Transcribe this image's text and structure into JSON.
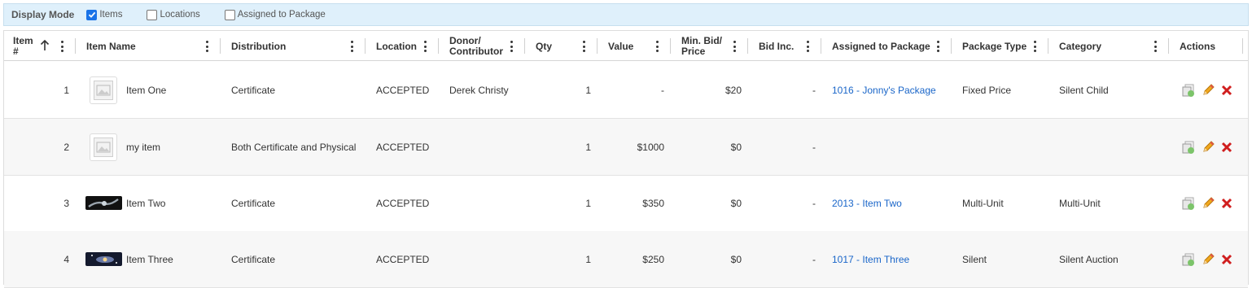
{
  "display_mode": {
    "label": "Display Mode",
    "options": [
      {
        "label": "Items",
        "checked": true
      },
      {
        "label": "Locations",
        "checked": false
      },
      {
        "label": "Assigned to Package",
        "checked": false
      }
    ]
  },
  "columns": {
    "item_no": [
      "Item",
      "#"
    ],
    "item_name": "Item Name",
    "distribution": "Distribution",
    "location": "Location",
    "donor": [
      "Donor/",
      "Contributor"
    ],
    "qty": "Qty",
    "value": "Value",
    "min_bid": [
      "Min. Bid/",
      "Price"
    ],
    "bid_inc": "Bid Inc.",
    "assigned": "Assigned to Package",
    "package_type": "Package Type",
    "category": "Category",
    "actions": "Actions"
  },
  "rows": [
    {
      "num": "1",
      "name": "Item One",
      "thumb": "placeholder",
      "distribution": "Certificate",
      "location": "ACCEPTED",
      "donor": "Derek Christy",
      "qty": "1",
      "value": "-",
      "min_bid": "$20",
      "bid_inc": "-",
      "assigned": "1016 - Jonny's Package",
      "package_type": "Fixed Price",
      "category": "Silent Child"
    },
    {
      "num": "2",
      "name": "my item",
      "thumb": "placeholder",
      "distribution": "Both Certificate and Physical",
      "location": "ACCEPTED",
      "donor": "",
      "qty": "1",
      "value": "$1000",
      "min_bid": "$0",
      "bid_inc": "-",
      "assigned": "",
      "package_type": "",
      "category": ""
    },
    {
      "num": "3",
      "name": "Item Two",
      "thumb": "photo-dark",
      "distribution": "Certificate",
      "location": "ACCEPTED",
      "donor": "",
      "qty": "1",
      "value": "$350",
      "min_bid": "$0",
      "bid_inc": "-",
      "assigned": "2013 - Item Two",
      "package_type": "Multi-Unit",
      "category": "Multi-Unit"
    },
    {
      "num": "4",
      "name": "Item Three",
      "thumb": "photo-space",
      "distribution": "Certificate",
      "location": "ACCEPTED",
      "donor": "",
      "qty": "1",
      "value": "$250",
      "min_bid": "$0",
      "bid_inc": "-",
      "assigned": "1017 - Item Three",
      "package_type": "Silent",
      "category": "Silent Auction"
    }
  ],
  "icons": {
    "checkbox": "checkbox-icon",
    "sort": "sort-ascending-icon",
    "column_menu": "kebab-menu-icon",
    "placeholder": "no-image-icon",
    "copy": "copy-icon",
    "edit": "pencil-icon",
    "delete": "delete-x-icon"
  },
  "colors": {
    "topbar_bg": "#dff0fb",
    "link": "#1a66c9",
    "checkbox_on": "#1a73e8",
    "delete": "#d01e1e",
    "edit": "#e39a1b"
  }
}
